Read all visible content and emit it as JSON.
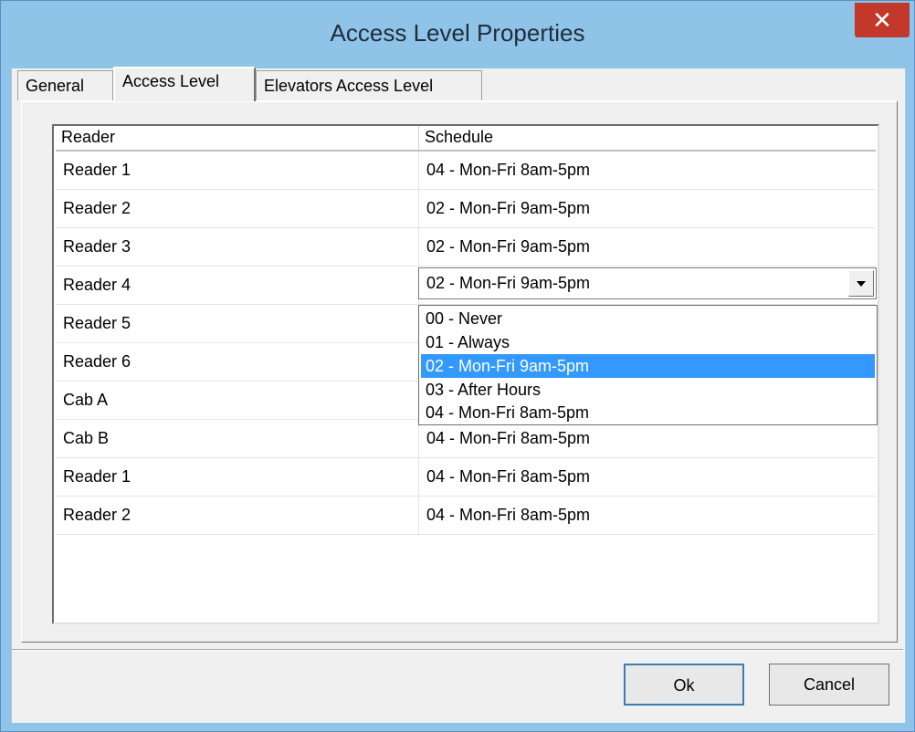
{
  "window": {
    "title": "Access Level Properties",
    "close_glyph": "✕"
  },
  "tabs": [
    {
      "label": "General",
      "active": false
    },
    {
      "label": "Access Level",
      "active": true
    },
    {
      "label": "Elevators Access Level",
      "active": false
    }
  ],
  "list": {
    "columns": {
      "reader": "Reader",
      "schedule": "Schedule"
    },
    "rows": [
      {
        "reader": "Reader 1",
        "schedule": "04 - Mon-Fri 8am-5pm"
      },
      {
        "reader": "Reader 2",
        "schedule": "02 - Mon-Fri 9am-5pm"
      },
      {
        "reader": "Reader 3",
        "schedule": "02 - Mon-Fri 9am-5pm"
      },
      {
        "reader": "Reader 4",
        "schedule": "02 - Mon-Fri 9am-5pm"
      },
      {
        "reader": "Reader 5",
        "schedule": ""
      },
      {
        "reader": "Reader 6",
        "schedule": ""
      },
      {
        "reader": "Cab A",
        "schedule": ""
      },
      {
        "reader": "Cab B",
        "schedule": "04 - Mon-Fri 8am-5pm"
      },
      {
        "reader": "Reader 1",
        "schedule": "04 - Mon-Fri 8am-5pm"
      },
      {
        "reader": "Reader 2",
        "schedule": "04 - Mon-Fri 8am-5pm"
      }
    ]
  },
  "schedule_combo": {
    "value": "02 - Mon-Fri 9am-5pm",
    "options": [
      "00 - Never",
      "01 - Always",
      "02 - Mon-Fri 9am-5pm",
      "03 - After Hours",
      "04 - Mon-Fri 8am-5pm"
    ],
    "selected_index": 2
  },
  "buttons": {
    "ok": "Ok",
    "cancel": "Cancel"
  },
  "colors": {
    "titlebar": "#8fc3e8",
    "close": "#c2392b",
    "selection": "#3399ff",
    "face": "#f0f0f0"
  }
}
